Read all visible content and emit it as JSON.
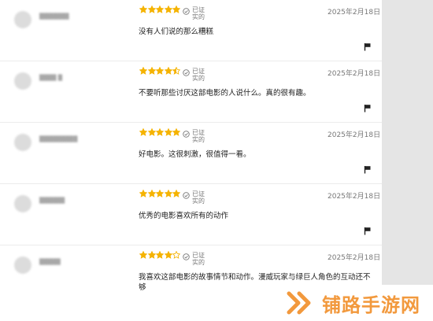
{
  "reviews": [
    {
      "user": "▒▒▒▒▒▒▒",
      "rating": 5,
      "verified_label": "已证实的",
      "date": "2025年2月18日",
      "text": "没有人们说的那么糟糕"
    },
    {
      "user": "▒▒▒▒ ▒",
      "rating": 4.5,
      "verified_label": "已证实的",
      "date": "2025年2月18日",
      "text": "不要听那些讨厌这部电影的人说什么。真的很有趣。"
    },
    {
      "user": "▒▒▒▒▒▒▒▒▒",
      "rating": 5,
      "verified_label": "已证实的",
      "date": "2025年2月18日",
      "text": "好电影。这很刺激，很值得一看。"
    },
    {
      "user": "▒▒▒▒▒▒",
      "rating": 5,
      "verified_label": "已证实的",
      "date": "2025年2月18日",
      "text": "优秀的电影喜欢所有的动作"
    },
    {
      "user": "▒▒▒▒▒",
      "rating": 4,
      "verified_label": "已证实的",
      "date": "2025年2月18日",
      "text": "我喜欢这部电影的故事情节和动作。漫威玩家与绿巨人角色的互动还不够"
    }
  ],
  "watermark": {
    "text": "铺路手游网"
  },
  "colors": {
    "star": "#f5b301",
    "star_empty_stroke": "#f5b301",
    "watermark": "#f2993d"
  },
  "icons": {
    "verified": "check-circle-icon",
    "report": "flag-icon"
  }
}
